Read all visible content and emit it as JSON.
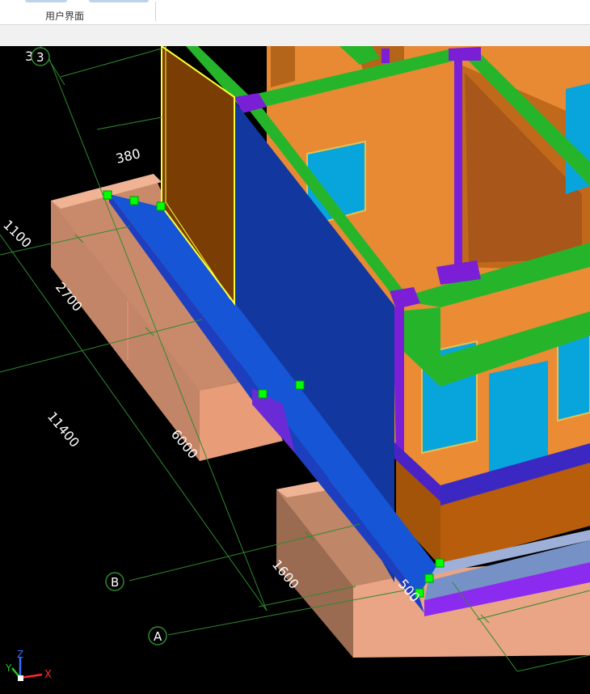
{
  "ribbon": {
    "group_label": "用户界面"
  },
  "viewport": {
    "axis_bubbles": [
      "B",
      "A",
      "3"
    ],
    "top_left_dimension": "380",
    "dimensions": [
      "380",
      "1100",
      "2700",
      "11400",
      "6000",
      "1600",
      "500"
    ],
    "triad": {
      "x": "X",
      "y": "Y",
      "z": "Z"
    }
  },
  "colors": {
    "background": "#000000",
    "grid": "#2f8a2f",
    "wall_interior": "#e88a33",
    "wall_dark": "#7a3e05",
    "beam_green": "#26b52a",
    "column_purple": "#7a1fd6",
    "selected_wall": "#1238a0",
    "selected_beam": "#1655d6",
    "foundation": "#e8a583",
    "window": "#08a5dc",
    "grip": "#00ff00",
    "selection_outline": "#ffff33"
  }
}
